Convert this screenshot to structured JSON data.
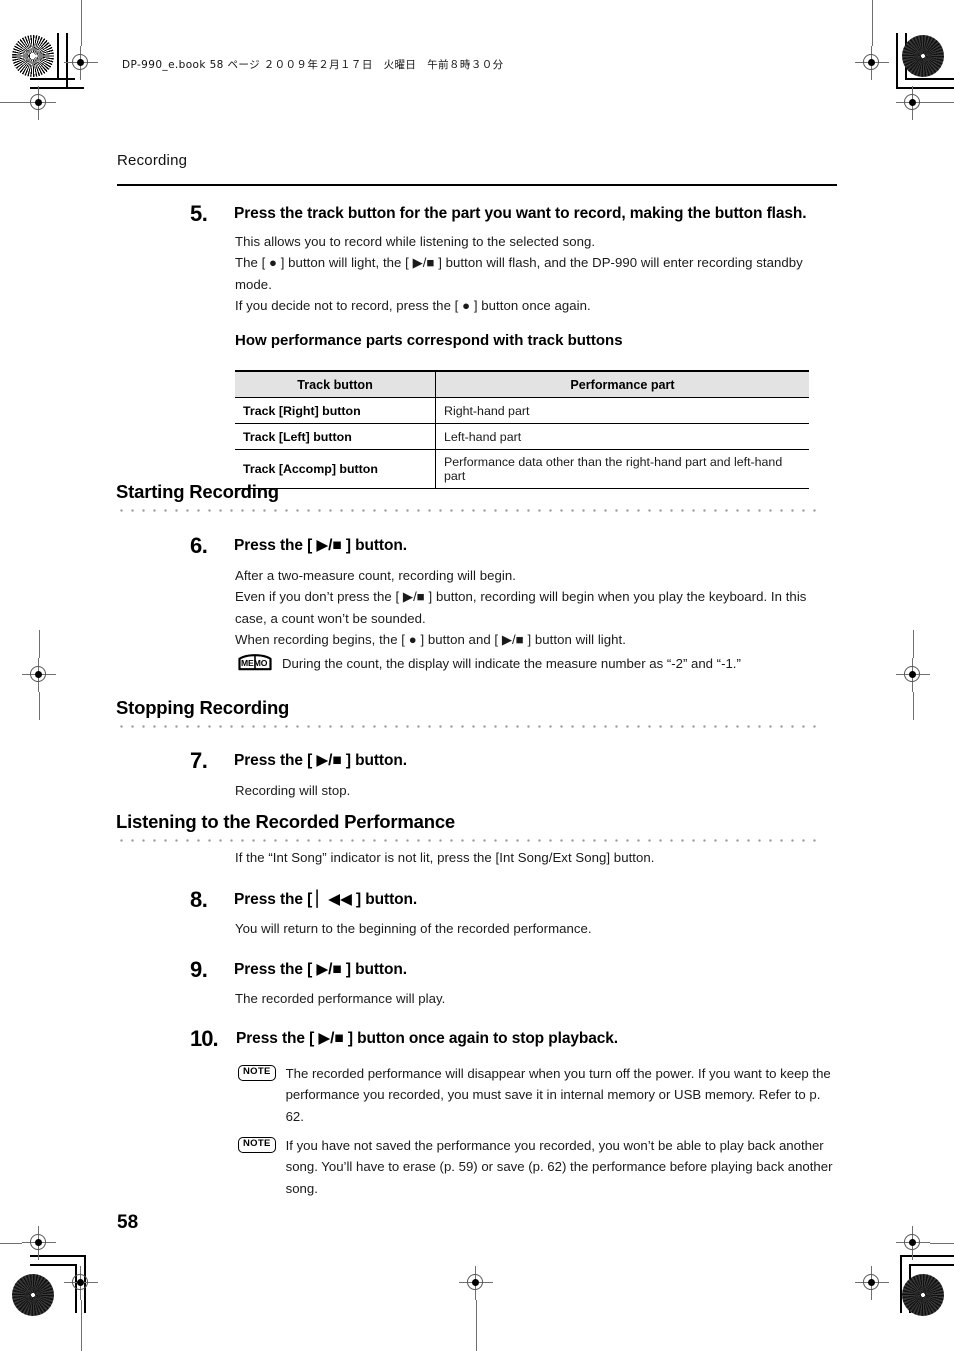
{
  "print_marks": {
    "file_info": "DP-990_e.book  58 ページ  ２００９年２月１７日　火曜日　午前８時３０分"
  },
  "page": {
    "running_head": "Recording",
    "folio": "58"
  },
  "steps": [
    {
      "number": "5.",
      "title": "Press the track button for the part you want to record, making the button flash.",
      "lines": [
        "This allows you to record while listening to the selected song.",
        "The [ ● ] button will light, the [ ▶/■ ] button will flash, and the DP-990 will enter recording standby mode.",
        "If you decide not to record, press the [ ● ] button once again."
      ]
    },
    {
      "number": "6.",
      "title": "Press the [ ▶/■ ] button.",
      "lines": [
        "After a two-measure count, recording will begin.",
        "Even if you don’t press the [ ▶/■ ] button, recording will begin when you play the keyboard. In this case, a count won’t be sounded.",
        "When recording begins, the [ ● ] button and [ ▶/■ ] button will light."
      ]
    },
    {
      "number": "7.",
      "title": "Press the [ ▶/■ ] button.",
      "lines": [
        "Recording will stop."
      ]
    },
    {
      "number": "8.",
      "title": "Press the [ ▏◀◀ ] button.",
      "lines": [
        "You will return to the beginning of the recorded performance."
      ]
    },
    {
      "number": "9.",
      "title": "Press the [ ▶/■ ] button.",
      "lines": [
        "The recorded performance will play."
      ]
    },
    {
      "number": "10.",
      "title": "Press the [ ▶/■ ] button once again to stop playback.",
      "lines": []
    }
  ],
  "table": {
    "caption": "How performance parts correspond with track buttons",
    "headers": [
      "Track button",
      "Performance part"
    ],
    "rows": [
      [
        "Track [Right] button",
        "Right-hand part"
      ],
      [
        "Track [Left] button",
        "Left-hand part"
      ],
      [
        "Track [Accomp] button",
        "Performance data other than the right-hand part and left-hand part"
      ]
    ]
  },
  "sections": [
    {
      "title": "Starting Recording"
    },
    {
      "title": "Stopping Recording"
    },
    {
      "title": "Listening to the Recorded Performance"
    }
  ],
  "listening_intro": "If the “Int Song” indicator is not lit, press the [Int Song/Ext Song] button.",
  "callouts": [
    {
      "badge": "MEMO",
      "text": "During the count, the display will indicate the measure number as “-2” and “-1.”"
    },
    {
      "badge": "NOTE",
      "text": "The recorded performance will disappear when you turn off the power. If you want to keep the performance you recorded, you must save it in internal memory or USB memory. Refer to p. 62."
    },
    {
      "badge": "NOTE",
      "text": "If you have not saved the performance you recorded, you won’t be able to play back another song. You’ll have to erase (p. 59) or save (p. 62) the performance before playing back another song."
    }
  ],
  "colors": {
    "text": "#000000",
    "table_header_bg": "#e3e3e3",
    "dot_rule": "#9a9a9a",
    "registration": "#6f6f6f"
  }
}
